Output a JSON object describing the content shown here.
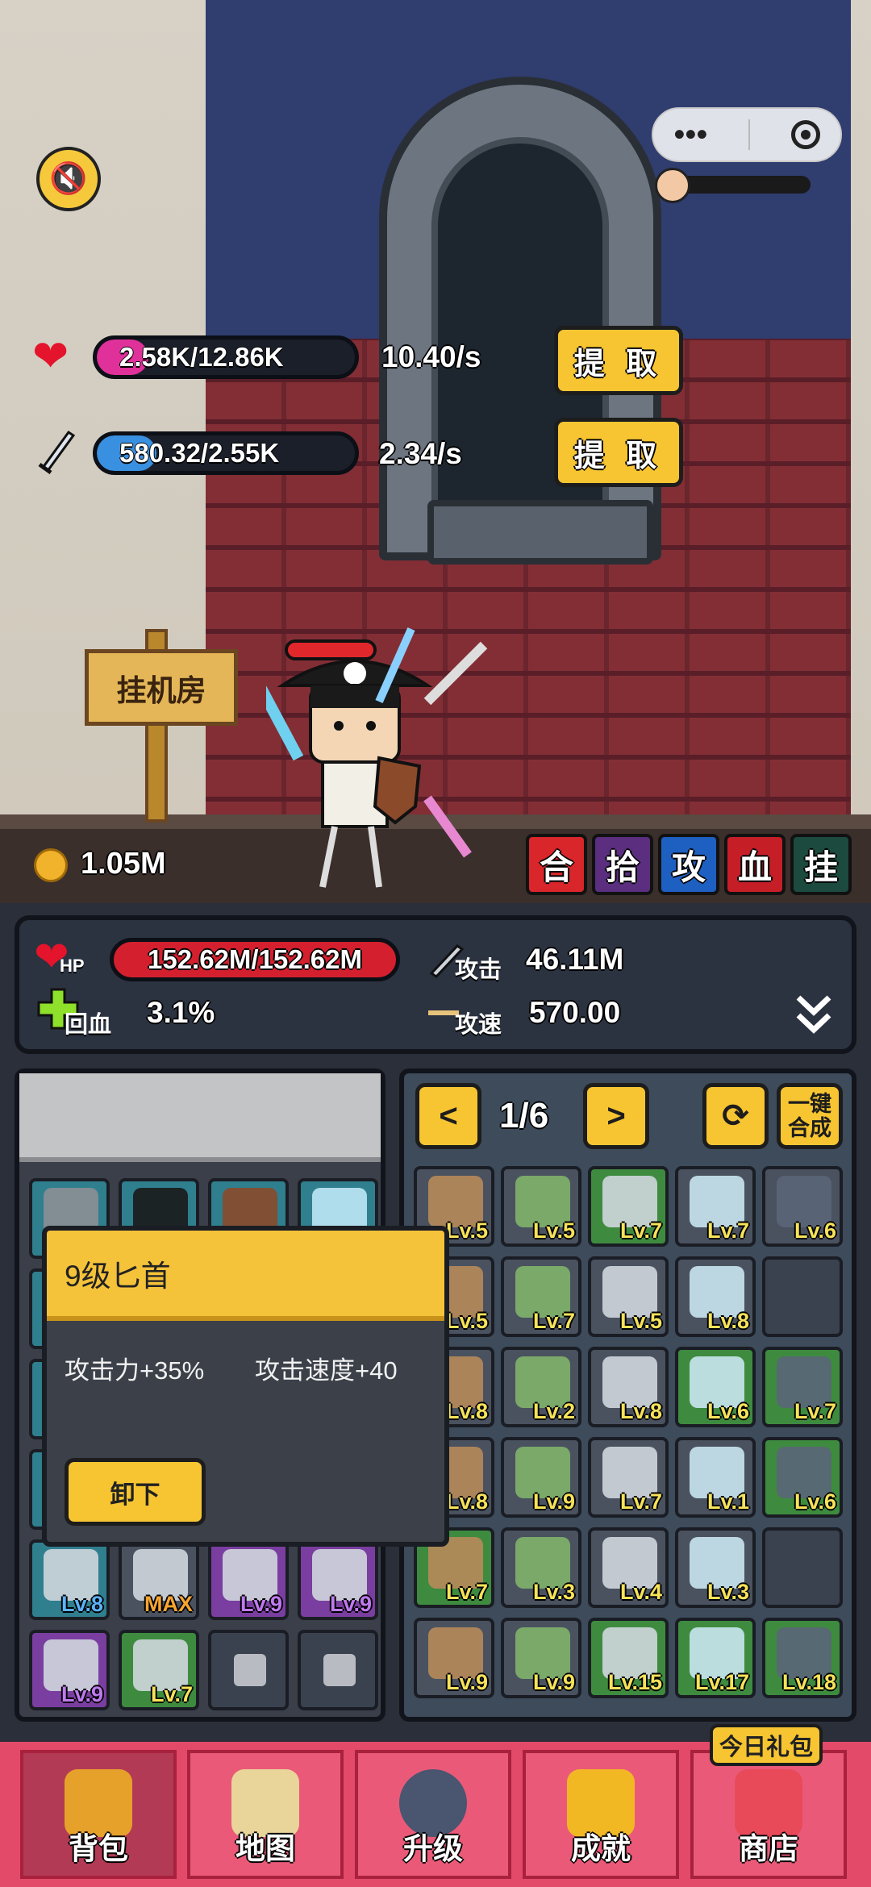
{
  "resources": {
    "health": {
      "value": "2.58K/12.86K",
      "fill_fraction": 0.2,
      "rate": "10.40/s",
      "button": "提 取",
      "color": "#e0309a"
    },
    "attack": {
      "value": "580.32/2.55K",
      "fill_fraction": 0.23,
      "rate": "2.34/s",
      "button": "提 取",
      "color": "#3a90e0"
    }
  },
  "sign_label": "挂机房",
  "coins": "1.05M",
  "action_buttons": [
    {
      "label": "合",
      "color": "#d8262b"
    },
    {
      "label": "拾",
      "color": "#5b2e80"
    },
    {
      "label": "攻",
      "color": "#1e5fc2"
    },
    {
      "label": "血",
      "color": "#c61e27"
    },
    {
      "label": "挂",
      "color": "#1c4a3e"
    }
  ],
  "stats": {
    "hp_label": "HP",
    "hp_value": "152.62M/152.62M",
    "attack_label": "攻击",
    "attack_value": "46.11M",
    "regen_label": "回血",
    "regen_value": "3.1%",
    "speed_label": "攻速",
    "speed_value": "570.00"
  },
  "inventory": {
    "pager": "1/6",
    "merge_all": "一键\n合成",
    "grid": [
      [
        "Lv.5",
        "Lv.5",
        "Lv.7",
        "Lv.7",
        "Lv.6"
      ],
      [
        "Lv.5",
        "Lv.7",
        "Lv.5",
        "Lv.8",
        ""
      ],
      [
        "Lv.8",
        "Lv.2",
        "Lv.8",
        "Lv.6",
        "Lv.7"
      ],
      [
        "Lv.8",
        "Lv.9",
        "Lv.7",
        "Lv.1",
        "Lv.6"
      ],
      [
        "Lv.7",
        "Lv.3",
        "Lv.4",
        "Lv.3",
        ""
      ],
      [
        "Lv.9",
        "Lv.9",
        "Lv.15",
        "Lv.17",
        "Lv.18"
      ]
    ]
  },
  "equipped": {
    "row5": [
      "Lv.8",
      "MAX",
      "Lv.9",
      "Lv.9"
    ],
    "row6": [
      "Lv.9",
      "Lv.7"
    ]
  },
  "popup": {
    "title": "9级匕首",
    "stat1": "攻击力+35%",
    "stat2": "攻击速度+40",
    "button": "卸下"
  },
  "nav": [
    {
      "label": "背包",
      "active": true
    },
    {
      "label": "地图",
      "active": false
    },
    {
      "label": "升级",
      "active": false
    },
    {
      "label": "成就",
      "active": false
    },
    {
      "label": "商店",
      "active": false
    }
  ],
  "gift_badge": "今日礼包"
}
